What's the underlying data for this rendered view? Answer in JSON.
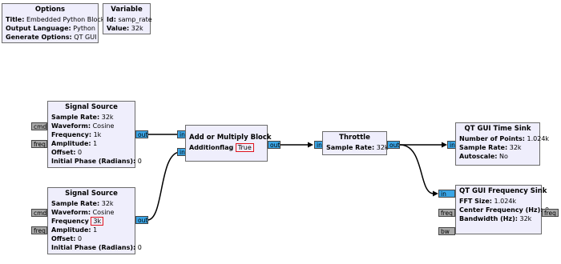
{
  "options": {
    "title": "Options",
    "rows": [
      {
        "key": "Title:",
        "value": "Embedded Python Block"
      },
      {
        "key": "Output Language:",
        "value": "Python"
      },
      {
        "key": "Generate Options:",
        "value": "QT GUI"
      }
    ]
  },
  "variable": {
    "title": "Variable",
    "rows": [
      {
        "key": "Id:",
        "value": "samp_rate"
      },
      {
        "key": "Value:",
        "value": "32k"
      }
    ]
  },
  "signal_source_1": {
    "title": "Signal Source",
    "rows": [
      {
        "key": "Sample Rate:",
        "value": "32k"
      },
      {
        "key": "Waveform:",
        "value": "Cosine"
      },
      {
        "key": "Frequency:",
        "value": "1k"
      },
      {
        "key": "Amplitude:",
        "value": "1"
      },
      {
        "key": "Offset:",
        "value": "0"
      },
      {
        "key": "Initial Phase (Radians):",
        "value": "0"
      }
    ],
    "ports": {
      "cmd": "cmd",
      "freq": "freq",
      "out": "out"
    }
  },
  "signal_source_2": {
    "title": "Signal Source",
    "rows": [
      {
        "key": "Sample Rate:",
        "value": "32k"
      },
      {
        "key": "Waveform:",
        "value": "Cosine"
      },
      {
        "key": "Frequency",
        "value": "3k"
      },
      {
        "key": "Amplitude:",
        "value": "1"
      },
      {
        "key": "Offset:",
        "value": "0"
      },
      {
        "key": "Initial Phase (Radians):",
        "value": "0"
      }
    ],
    "ports": {
      "cmd": "cmd",
      "freq": "freq",
      "out": "out"
    }
  },
  "add_multiply": {
    "title": "Add or Multiply Block",
    "flag_key": "Additionflag",
    "flag_value": "True",
    "ports": {
      "in1": "in",
      "in2": "in",
      "out": "out"
    }
  },
  "throttle": {
    "title": "Throttle",
    "rows": [
      {
        "key": "Sample Rate:",
        "value": "32k"
      }
    ],
    "ports": {
      "in": "in",
      "out": "out"
    }
  },
  "time_sink": {
    "title": "QT GUI Time Sink",
    "rows": [
      {
        "key": "Number of Points:",
        "value": "1.024k"
      },
      {
        "key": "Sample Rate:",
        "value": "32k"
      },
      {
        "key": "Autoscale:",
        "value": "No"
      }
    ],
    "ports": {
      "in": "in"
    }
  },
  "freq_sink": {
    "title": "QT GUI Frequency Sink",
    "rows": [
      {
        "key": "FFT Size:",
        "value": "1.024k"
      },
      {
        "key": "Center Frequency (Hz):",
        "value": "0"
      },
      {
        "key": "Bandwidth (Hz):",
        "value": "32k"
      }
    ],
    "ports": {
      "in": "in",
      "freq_in": "freq",
      "bw": "bw",
      "freq_out": "freq"
    }
  },
  "colors": {
    "block_bg": "#efeefc",
    "stream_port": "#3aa5e6",
    "message_port": "#a9a9a9",
    "highlight": "#e0141e"
  }
}
